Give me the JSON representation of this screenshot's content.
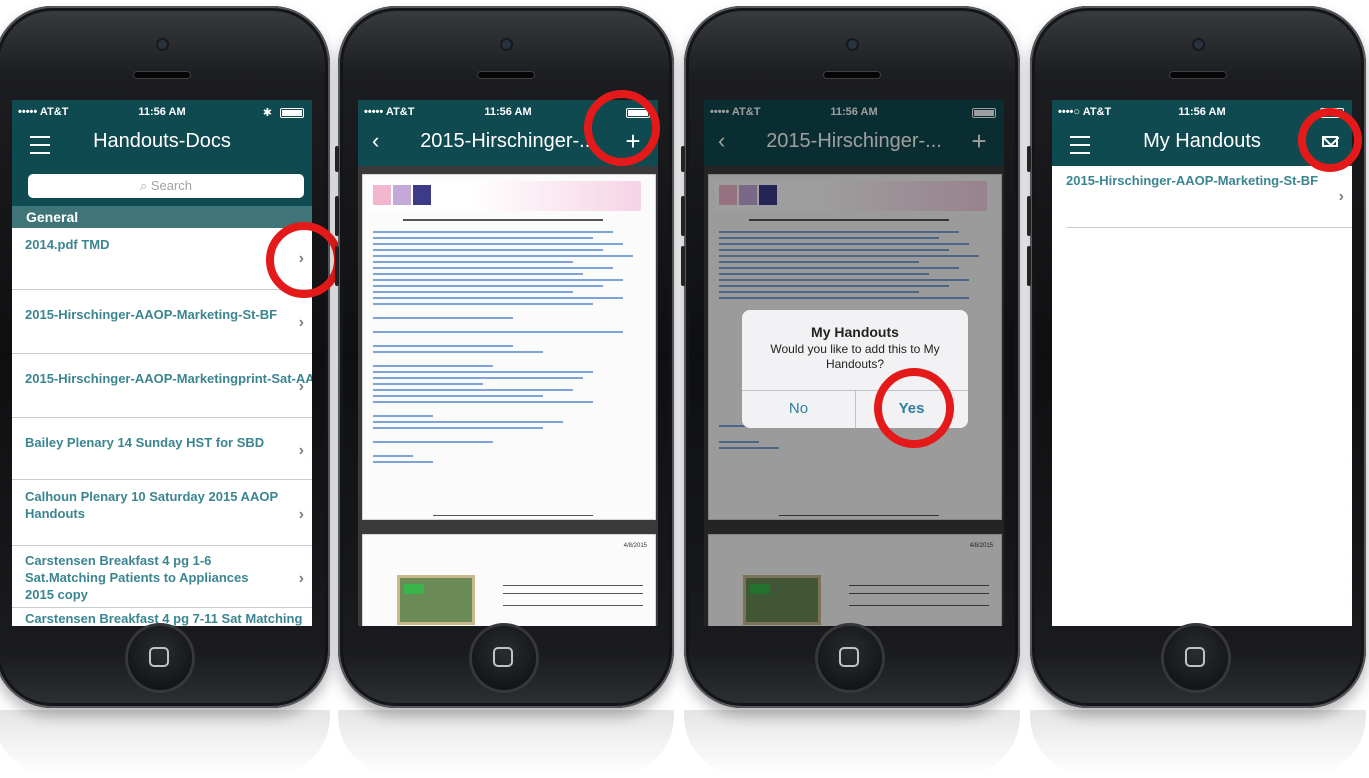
{
  "colors": {
    "nav": "#0f4a50",
    "section": "#3f7578",
    "link": "#3b8591",
    "highlight": "#e41a1a",
    "dialog_button": "#2f7ea0"
  },
  "status": {
    "carrier": "••••• AT&T",
    "carrier_alt": "••••○ AT&T",
    "time": "11:56 AM"
  },
  "screen1": {
    "title": "Handouts-Docs",
    "search_placeholder": "Search",
    "section": "General",
    "items": [
      {
        "label": "2014.pdf TMD"
      },
      {
        "label": "2015-Hirschinger-AAOP-Marketing-St-BF"
      },
      {
        "label": "2015-Hirschinger-AAOP-Marketingprint-Sat-AA"
      },
      {
        "label": "Bailey Plenary 14 Sunday HST for SBD"
      },
      {
        "label": "Calhoun Plenary 10 Saturday 2015 AAOP Handouts"
      },
      {
        "label": "Carstensen  Breakfast 4  pg 1-6 Sat.Matching Patients to Appliances 2015 copy"
      },
      {
        "label": "Carstensen  Breakfast 4  pg 7-11 Sat Matching"
      }
    ]
  },
  "screen2": {
    "title": "2015-Hirschinger-...",
    "doc_date": "4/8/2015"
  },
  "screen3": {
    "title": "2015-Hirschinger-...",
    "doc_date": "4/8/2015",
    "dialog": {
      "title": "My Handouts",
      "message": "Would you like to add this to My Handouts?",
      "no": "No",
      "yes": "Yes"
    }
  },
  "screen4": {
    "title": "My Handouts",
    "items": [
      {
        "label": "2015-Hirschinger-AAOP-Marketing-St-BF"
      }
    ]
  },
  "icons": [
    "menu-icon",
    "back-icon",
    "add-icon",
    "mail-icon",
    "search-icon",
    "chevron-right-icon",
    "bluetooth-icon",
    "battery-icon",
    "wifi-icon"
  ]
}
